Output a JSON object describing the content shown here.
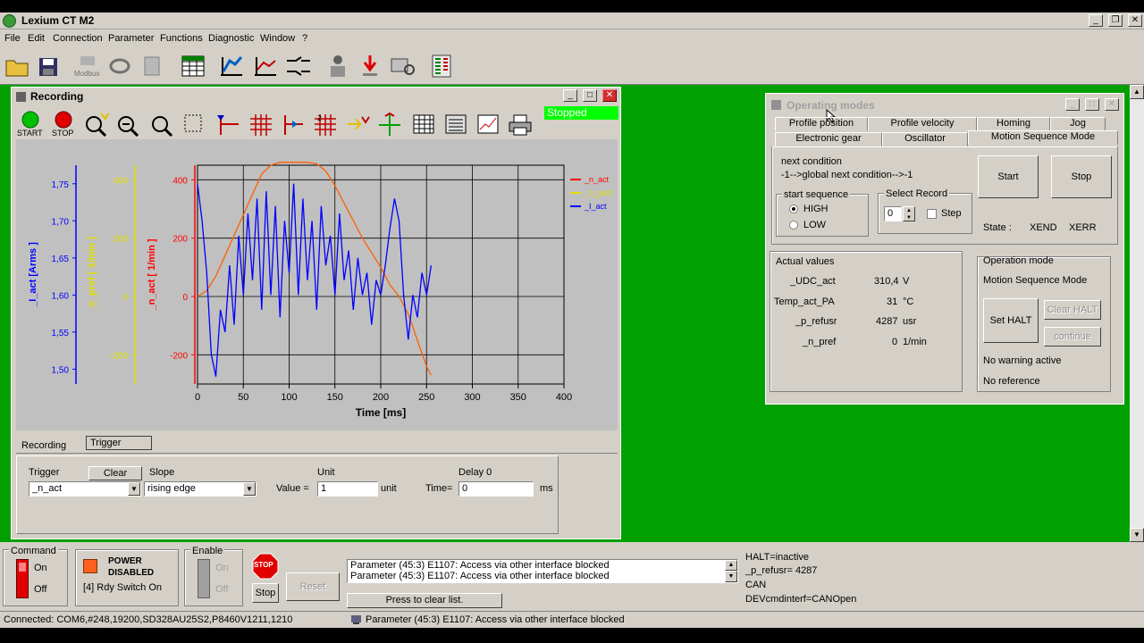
{
  "app": {
    "title": "Lexium CT M2"
  },
  "menu": [
    "File",
    "Edit",
    "Connection",
    "Parameter",
    "Functions",
    "Diagnostic",
    "Window",
    "?"
  ],
  "toolbar": {
    "modbus_label": "Modbus"
  },
  "recording": {
    "title": "Recording",
    "start_label": "START",
    "stop_label": "STOP",
    "status": "Stopped",
    "tabs": [
      "Recording",
      "Trigger"
    ],
    "trigger": {
      "trigger_label": "Trigger",
      "clear_label": "Clear",
      "slope_label": "Slope",
      "unit_label": "Unit",
      "delay_label": "Delay 0",
      "trigger_value": "_n_act",
      "slope_value": "rising edge",
      "value_label": "Value =",
      "value": "1",
      "unit_suffix": "unit",
      "time_label": "Time=",
      "time_value": "0",
      "ms_suffix": "ms"
    }
  },
  "chart_data": {
    "type": "line",
    "xlabel": "Time [ms]",
    "xlim": [
      0,
      400
    ],
    "x_ticks": [
      "0",
      "50",
      "100",
      "150",
      "200",
      "250",
      "300",
      "350",
      "400"
    ],
    "axes": [
      {
        "label": "_I_act   [Arms ]",
        "color": "#0000ff",
        "ticks": [
          "1,75",
          "1,70",
          "1,65",
          "1,60",
          "1,55",
          "1,50"
        ]
      },
      {
        "label": "_n_pref   [ 1/min ]",
        "color": "#e0e000",
        "ticks": [
          "400",
          "200",
          "0",
          "-200"
        ]
      },
      {
        "label": "_n_act   [ 1/min ]",
        "color": "#ff0000",
        "ticks": [
          "400",
          "200",
          "0",
          "-200"
        ]
      }
    ],
    "ylim_rpm": [
      -300,
      450
    ],
    "legend": [
      "_n_act",
      "_n_pref",
      "_I_act"
    ],
    "legend_colors": [
      "#ff0000",
      "#e0e000",
      "#0000ff"
    ],
    "series": [
      {
        "name": "_n_act",
        "color": "#ff6000",
        "x": [
          0,
          10,
          20,
          30,
          40,
          50,
          60,
          70,
          80,
          90,
          100,
          110,
          120,
          130,
          140,
          150,
          160,
          170,
          180,
          190,
          200,
          210,
          220,
          230,
          240,
          250,
          255
        ],
        "y": [
          0,
          20,
          70,
          140,
          210,
          280,
          350,
          420,
          450,
          460,
          460,
          460,
          460,
          455,
          430,
          380,
          320,
          260,
          200,
          150,
          100,
          40,
          0,
          -60,
          -150,
          -240,
          -270
        ]
      },
      {
        "name": "_I_act",
        "color": "#0000ff",
        "x": [
          0,
          5,
          10,
          15,
          20,
          25,
          30,
          35,
          40,
          45,
          50,
          55,
          60,
          65,
          70,
          75,
          80,
          85,
          90,
          95,
          100,
          105,
          110,
          115,
          120,
          125,
          130,
          135,
          140,
          145,
          150,
          155,
          160,
          165,
          170,
          175,
          180,
          185,
          190,
          195,
          200,
          205,
          210,
          215,
          220,
          225,
          230,
          235,
          240,
          245,
          250,
          255
        ],
        "y": [
          1.75,
          1.7,
          1.63,
          1.52,
          1.49,
          1.58,
          1.55,
          1.64,
          1.56,
          1.68,
          1.6,
          1.71,
          1.62,
          1.73,
          1.58,
          1.74,
          1.6,
          1.72,
          1.57,
          1.7,
          1.63,
          1.75,
          1.6,
          1.73,
          1.62,
          1.7,
          1.58,
          1.72,
          1.64,
          1.68,
          1.6,
          1.71,
          1.62,
          1.66,
          1.58,
          1.65,
          1.6,
          1.63,
          1.56,
          1.62,
          1.6,
          1.64,
          1.69,
          1.73,
          1.7,
          1.6,
          1.54,
          1.6,
          1.57,
          1.63,
          1.6,
          1.64
        ]
      }
    ]
  },
  "operating_modes": {
    "title": "Operating modes",
    "tabs_row1": [
      "Profile position",
      "Profile velocity",
      "Homing",
      "Jog"
    ],
    "tabs_row2": [
      "Electronic gear",
      "Oscillator",
      "Motion Sequence Mode"
    ],
    "next_condition": "next condition",
    "next_condition_value": "-1-->global next condition-->-1",
    "start_sequence_label": "start sequence",
    "high_label": "HIGH",
    "low_label": "LOW",
    "select_record_label": "Select Record",
    "record_value": "0",
    "step_label": "Step",
    "start_button": "Start",
    "stop_button": "Stop",
    "state_label": "State :",
    "xend": "XEND",
    "xerr": "XERR",
    "actual_values_label": "Actual values",
    "actual_values": [
      {
        "name": "_UDC_act",
        "value": "310,4",
        "unit": "V"
      },
      {
        "name": "Temp_act_PA",
        "value": "31",
        "unit": "°C"
      },
      {
        "name": "_p_refusr",
        "value": "4287",
        "unit": "usr"
      },
      {
        "name": "_n_pref",
        "value": "0",
        "unit": "1/min"
      }
    ],
    "operation_mode_label": "Operation mode",
    "operation_mode_value": "Motion Sequence Mode",
    "set_halt": "Set HALT",
    "clear_halt": "Clear HALT",
    "continue": "continue",
    "warning": "No warning active",
    "reference": "No reference"
  },
  "status_panel": {
    "command_label": "Command",
    "on_label": "On",
    "off_label": "Off",
    "power_line1": "POWER",
    "power_line2": "DISABLED",
    "rdy_state": "[4] Rdy Switch On",
    "enable_label": "Enable",
    "enable_on": "On",
    "enable_off": "Off",
    "stop_sign": "STOP",
    "stop_button": "Stop",
    "reset_button": "Reset",
    "messages": [
      "Parameter (45:3)  E1107: Access via other interface blocked",
      "Parameter (45:3)  E1107: Access via other interface blocked"
    ],
    "clear_list": "Press to clear list.",
    "info": [
      "HALT=inactive",
      "_p_refusr= 4287",
      "CAN",
      "DEVcmdinterf=CANOpen"
    ]
  },
  "statusbar": {
    "connection": "Connected: COM6,#248,19200,SD328AU25S2,P8460V1211,1210",
    "last_message": "Parameter (45:3)  E1107: Access via other interface blocked"
  }
}
